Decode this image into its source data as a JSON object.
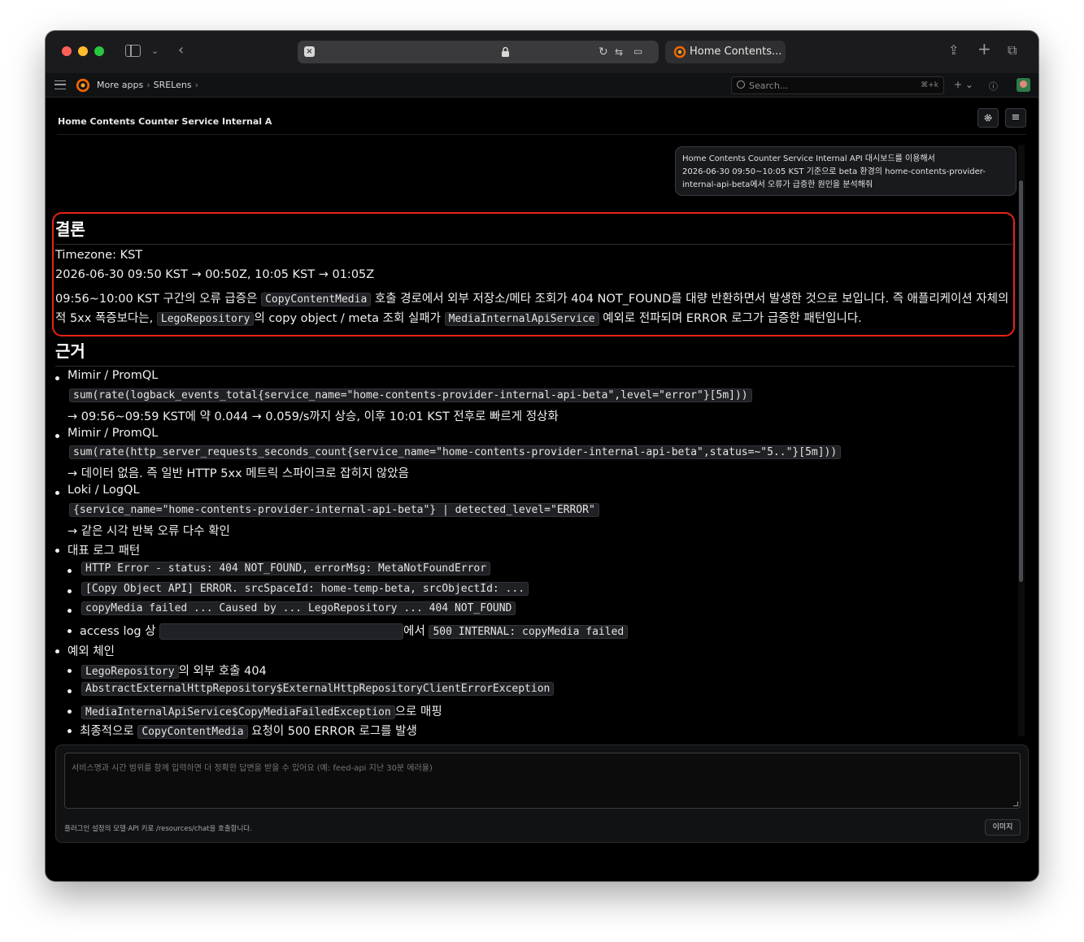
{
  "browser": {
    "tab_title": "Home Contents...",
    "colors": {
      "window_bg": "#000000",
      "toolbar_bg": "#1b1b1d",
      "accent_red": "#e8231b"
    }
  },
  "nav": {
    "breadcrumbs": [
      "More apps",
      "SRELens"
    ],
    "search_placeholder": "Search...",
    "search_shortcut": "⌘+k",
    "add_label": "+ ⌄"
  },
  "page": {
    "title": "Home Contents Counter Service Internal A"
  },
  "chat": {
    "user_message": {
      "line1": "Home Contents Counter Service Internal API 대시보드를 이용해서",
      "line2": "2026-06-30 09:50~10:05 KST 기준으로 beta 환경의 home-contents-provider-",
      "line3": "internal-api-beta에서 오류가 급증한 원인을 분석해줘"
    },
    "conclusion": {
      "heading": "결론",
      "timezone": "Timezone: KST",
      "time_range": "2026-06-30 09:50 KST → 00:50Z, 10:05 KST → 01:05Z",
      "p1_a": "09:56~10:00 KST 구간의 오류 급증은",
      "p1_code1": "CopyContentMedia",
      "p1_b": "호출 경로에서 외부 저장소/메타 조회가 404 NOT_FOUND를 대량 반환하면서 발생한 것으로 보입니다. 즉 애플리케이션 자체의 일반",
      "p2_a": "적 5xx 폭증보다는,",
      "p2_code1": "LegoRepository",
      "p2_b": "의 copy object / meta 조회 실패가",
      "p2_code2": "MediaInternalApiService",
      "p2_c": "예외로 전파되며 ERROR 로그가 급증한 패턴입니다."
    },
    "evidence": {
      "heading": "근거",
      "items": [
        {
          "title": "Mimir / PromQL",
          "query": "sum(rate(logback_events_total{service_name=\"home-contents-provider-internal-api-beta\",level=\"error\"}[5m]))",
          "result": "→ 09:56~09:59 KST에 약 0.044 → 0.059/s까지 상승, 이후 10:01 KST 전후로 빠르게 정상화"
        },
        {
          "title": "Mimir / PromQL",
          "query": "sum(rate(http_server_requests_seconds_count{service_name=\"home-contents-provider-internal-api-beta\",status=~\"5..\"}[5m]))",
          "result": "→ 데이터 없음. 즉 일반 HTTP 5xx 메트릭 스파이크로 잡히지 않았음"
        },
        {
          "title": "Loki / LogQL",
          "query": "{service_name=\"home-contents-provider-internal-api-beta\"} | detected_level=\"ERROR\"",
          "result": "→ 같은 시각 반복 오류 다수 확인"
        }
      ],
      "log_patterns_title": "대표 로그 패턴",
      "log_patterns": [
        "HTTP Error - status: 404 NOT_FOUND, errorMsg: MetaNotFoundError",
        "[Copy Object API] ERROR. srcSpaceId: home-temp-beta, srcObjectId: ...",
        "copyMedia failed ... Caused by ... LegoRepository ... 404 NOT_FOUND"
      ],
      "access_log_prefix": "access log 상",
      "access_log_mid": "에서",
      "access_log_code": "500 INTERNAL: copyMedia failed",
      "exception_chain_title": "예외 체인",
      "chain_1_code": "LegoRepository",
      "chain_1_text": "의 외부 호출 404",
      "chain_2_code": "AbstractExternalHttpRepository$ExternalHttpRepositoryClientErrorException",
      "chain_3_code": "MediaInternalApiService$CopyMediaFailedException",
      "chain_3_text": "으로 매핑",
      "chain_4_prefix": "최종적으로",
      "chain_4_code": "CopyContentMedia",
      "chain_4_text": "요청이 500 ERROR 로그를 발생"
    }
  },
  "composer": {
    "placeholder": "서비스명과 시간 범위를 함께 입력하면 더 정확한 답변을 받을 수 있어요 (예: feed-api 지난 30분 에러율)",
    "note": "플러그인 설정의 모델·API 키로 /resources/chat을 호출합니다.",
    "image_button": "이미지"
  }
}
